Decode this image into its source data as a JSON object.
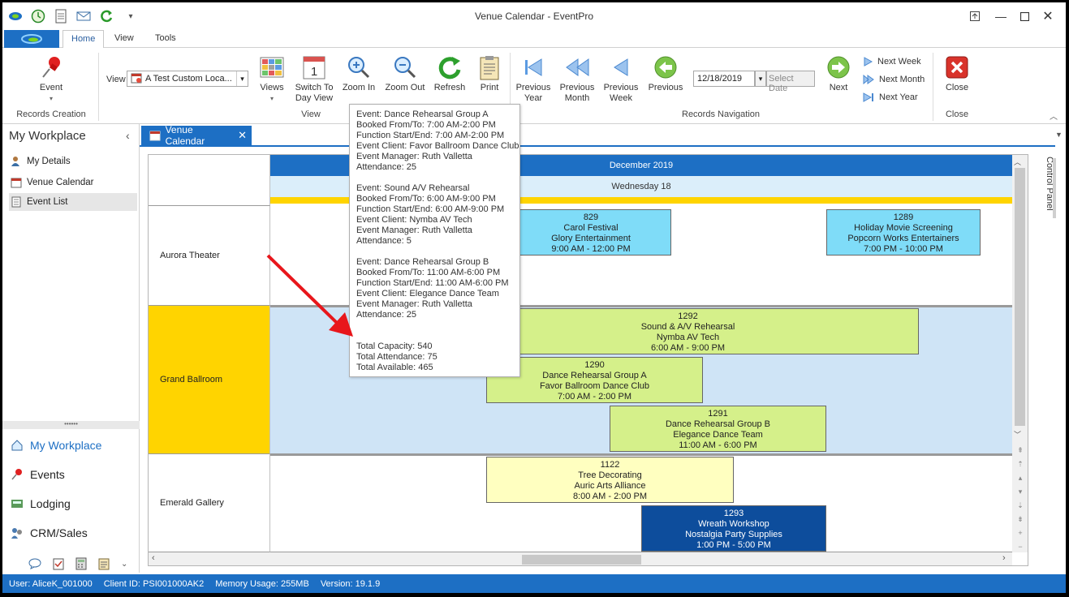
{
  "window": {
    "title": "Venue Calendar - EventPro"
  },
  "ribbon": {
    "tabs": [
      {
        "label": "Home"
      },
      {
        "label": "View"
      },
      {
        "label": "Tools"
      }
    ],
    "records_creation": {
      "event_label": "Event",
      "group_label": "Records Creation"
    },
    "view_group": {
      "view_label": "View",
      "view_value": "A Test Custom Loca...",
      "views_label": "Views",
      "switch_label_1": "Switch To",
      "switch_label_2": "Day View",
      "zoom_in": "Zoom In",
      "zoom_out": "Zoom Out",
      "refresh": "Refresh",
      "print": "Print",
      "group_label": "View"
    },
    "nav_group": {
      "prev_year_1": "Previous",
      "prev_year_2": "Year",
      "prev_month_1": "Previous",
      "prev_month_2": "Month",
      "prev_week_1": "Previous",
      "prev_week_2": "Week",
      "previous": "Previous",
      "date_value": "12/18/2019",
      "select_date": "Select Date",
      "next": "Next",
      "next_week": "Next Week",
      "next_month": "Next Month",
      "next_year": "Next Year",
      "group_label": "Records Navigation"
    },
    "close_group": {
      "close": "Close",
      "group_label": "Close"
    }
  },
  "sidebar": {
    "title": "My Workplace",
    "items": [
      {
        "label": "My Details"
      },
      {
        "label": "Venue Calendar"
      },
      {
        "label": "Event List"
      }
    ],
    "nav": [
      {
        "label": "My Workplace"
      },
      {
        "label": "Events"
      },
      {
        "label": "Lodging"
      },
      {
        "label": "CRM/Sales"
      }
    ]
  },
  "document_tab": {
    "label": "Venue Calendar"
  },
  "calendar": {
    "month": "December 2019",
    "day": "Wednesday 18",
    "control_panel": "Control Panel",
    "venues": [
      {
        "name": "Aurora Theater"
      },
      {
        "name": "Grand Ballroom"
      },
      {
        "name": "Emerald Gallery"
      }
    ],
    "events": [
      {
        "id": "829",
        "name": "Carol Festival",
        "client": "Glory Entertainment",
        "time": "9:00 AM - 12:00 PM"
      },
      {
        "id": "1289",
        "name": "Holiday Movie Screening",
        "client": "Popcorn Works Entertainers",
        "time": "7:00 PM - 10:00 PM"
      },
      {
        "id": "1292",
        "name": "Sound & A/V Rehearsal",
        "client": "Nymba AV Tech",
        "time": "6:00 AM - 9:00 PM"
      },
      {
        "id": "1290",
        "name": "Dance Rehearsal Group A",
        "client": "Favor Ballroom Dance Club",
        "time": "7:00 AM - 2:00 PM"
      },
      {
        "id": "1291",
        "name": "Dance Rehearsal Group B",
        "client": "Elegance Dance Team",
        "time": "11:00 AM - 6:00 PM"
      },
      {
        "id": "1122",
        "name": "Tree Decorating",
        "client": "Auric Arts Alliance",
        "time": "8:00 AM - 2:00 PM"
      },
      {
        "id": "1293",
        "name": "Wreath Workshop",
        "client": "Nostalgia Party Supplies",
        "time": "1:00 PM - 5:00 PM"
      }
    ]
  },
  "tooltip": {
    "lines": [
      "Event: Dance Rehearsal Group A",
      "Booked From/To: 7:00 AM-2:00 PM",
      "Function Start/End: 7:00 AM-2:00 PM",
      "Event Client: Favor Ballroom Dance Club",
      "Event Manager: Ruth Valletta",
      "Attendance: 25",
      "",
      "Event: Sound  A/V Rehearsal",
      "Booked From/To: 6:00 AM-9:00 PM",
      "Function Start/End: 6:00 AM-9:00 PM",
      "Event Client: Nymba AV Tech",
      "Event Manager: Ruth Valletta",
      "Attendance: 5",
      "",
      "Event: Dance Rehearsal Group B",
      "Booked From/To: 11:00 AM-6:00 PM",
      "Function Start/End: 11:00 AM-6:00 PM",
      "Event Client: Elegance Dance Team",
      "Event Manager: Ruth Valletta",
      "Attendance: 25",
      "",
      "",
      "Total Capacity: 540",
      "Total Attendance: 75",
      "Total Available: 465"
    ]
  },
  "status": {
    "user": "User: AliceK_001000",
    "client": "Client ID: PSI001000AK2",
    "memory": "Memory Usage: 255MB",
    "version": "Version: 19.1.9"
  },
  "colors": {
    "accent": "#1d6fc4",
    "event_cyan": "#7fdcf8",
    "event_green": "#d5f08a",
    "event_yellow": "#ffffc0",
    "event_navy": "#0d4d9c",
    "ballroom_yellow": "#ffd400"
  }
}
